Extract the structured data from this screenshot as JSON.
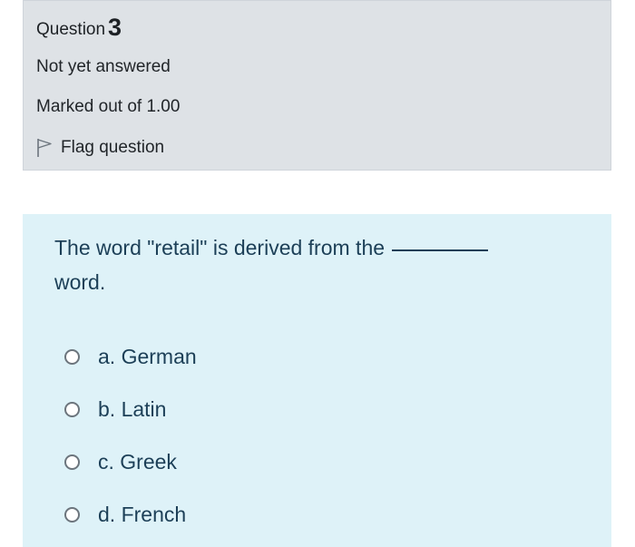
{
  "info": {
    "question_prefix": "Question",
    "question_number": "3",
    "state": "Not yet answered",
    "grade": "Marked out of 1.00",
    "flag_label": "Flag question"
  },
  "question": {
    "text_before": "The word \"retail\" is derived from the",
    "text_after": "word."
  },
  "options": [
    {
      "label": "a. German",
      "selected": false
    },
    {
      "label": "b. Latin",
      "selected": false
    },
    {
      "label": "c. Greek",
      "selected": false
    },
    {
      "label": "d. French",
      "selected": false
    }
  ],
  "colors": {
    "info_bg": "#dee2e6",
    "formulation_bg": "#def2f8",
    "question_text": "#1c3f57"
  },
  "icons": {
    "flag": "flag-icon",
    "radio": "radio-icon"
  }
}
